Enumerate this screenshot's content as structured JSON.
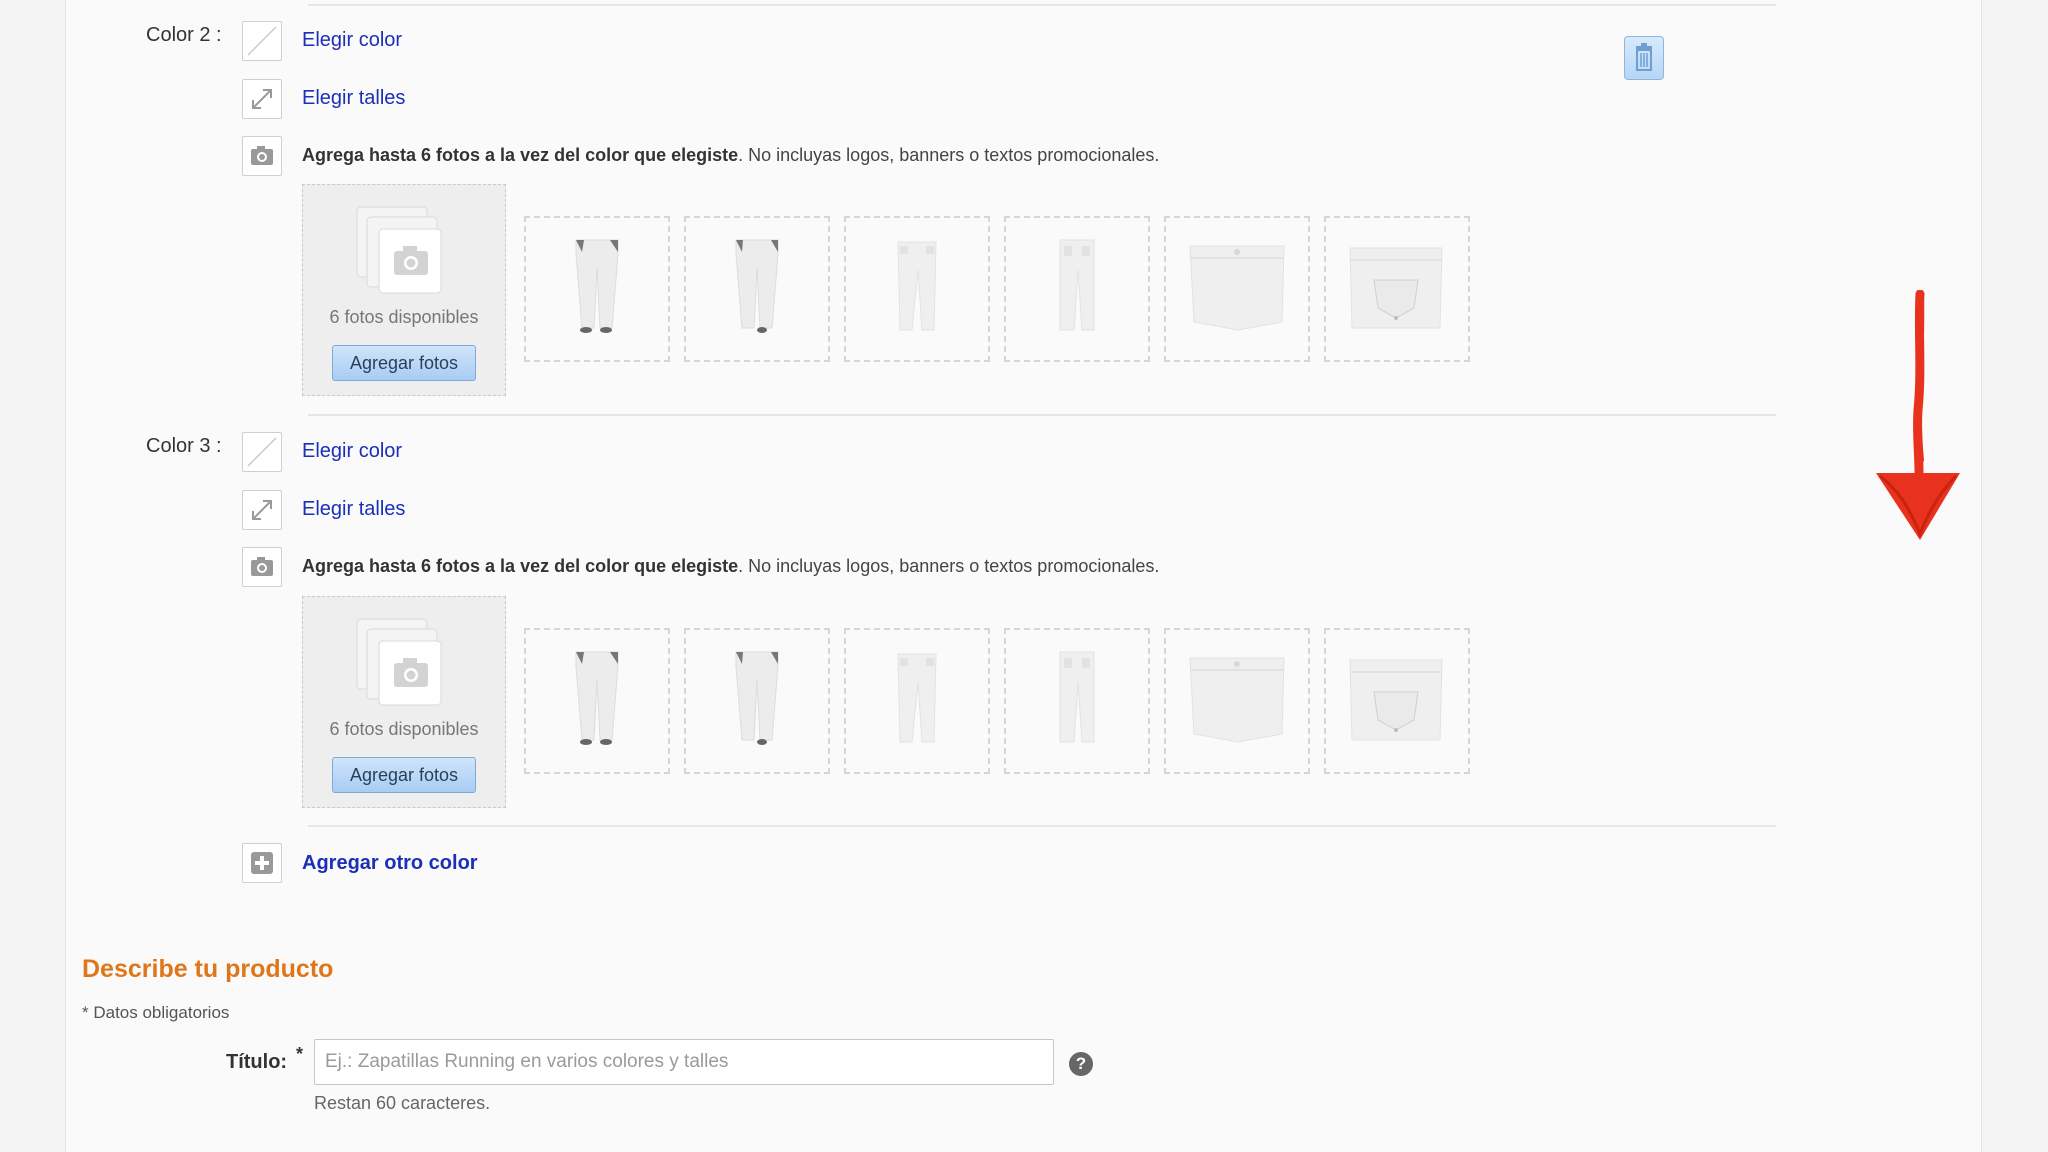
{
  "colors": [
    {
      "label": "Color 2 :",
      "choose_color": "Elegir color",
      "choose_sizes": "Elegir talles",
      "instruction_bold": "Agrega hasta 6 fotos a la vez del color que elegiste",
      "instruction_rest": ". No incluyas logos, banners o textos promocionales.",
      "available_photos": "6 fotos disponibles",
      "add_photos_button": "Agregar fotos"
    },
    {
      "label": "Color 3 :",
      "choose_color": "Elegir color",
      "choose_sizes": "Elegir talles",
      "instruction_bold": "Agrega hasta 6 fotos a la vez del color que elegiste",
      "instruction_rest": ". No incluyas logos, banners o textos promocionales.",
      "available_photos": "6 fotos disponibles",
      "add_photos_button": "Agregar fotos"
    }
  ],
  "example_photo_icons": [
    "pants-front-icon",
    "pants-back-icon",
    "pants-side-icon",
    "pants-side-back-icon",
    "pants-waist-icon",
    "pants-pocket-icon"
  ],
  "add_color_link": "Agregar otro color",
  "describe_section": {
    "title": "Describe tu producto",
    "required_note": "* Datos obligatorios",
    "title_field_label": "Título:",
    "required_mark": "*",
    "title_placeholder": "Ej.: Zapatillas Running en varios colores y talles",
    "title_value": "",
    "chars_remaining": "Restan 60 caracteres.",
    "help_glyph": "?"
  },
  "theme": {
    "link_color": "#1b2fb8",
    "section_title_color": "#e0761a",
    "button_color": "#b8d8f8",
    "annotation_arrow_color": "#e8321e"
  }
}
